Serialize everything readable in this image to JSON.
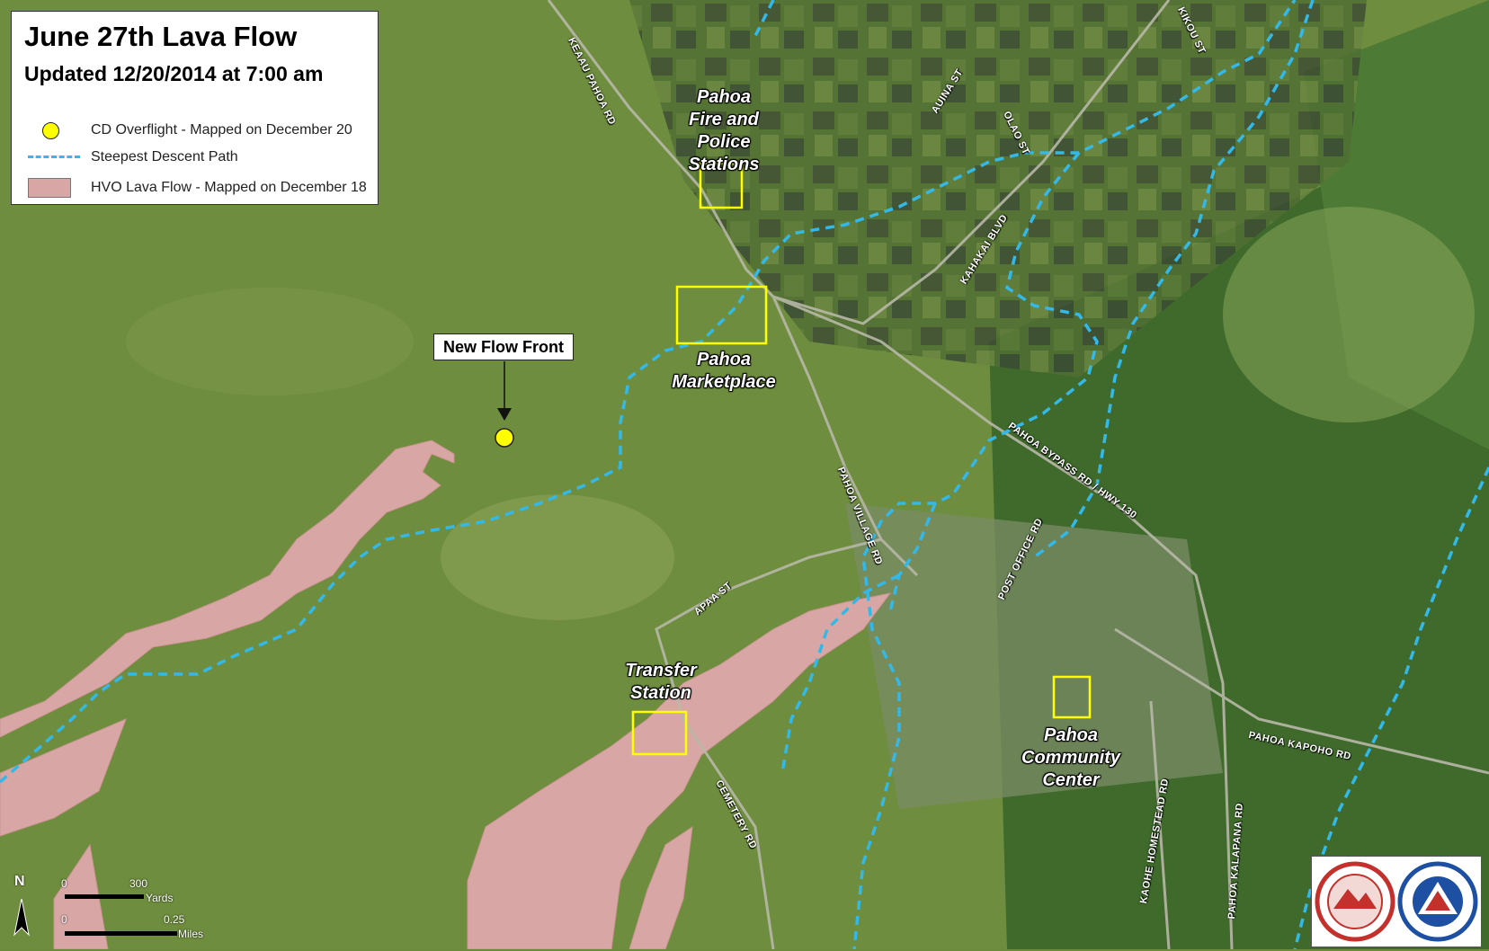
{
  "legend": {
    "title": "June 27th Lava Flow",
    "updated": "Updated 12/20/2014 at 7:00 am",
    "items": [
      {
        "label": "CD Overflight - Mapped on December 20",
        "icon": "yellow-dot-icon"
      },
      {
        "label": "Steepest Descent Path",
        "icon": "dashed-line-icon"
      },
      {
        "label": "HVO Lava Flow - Mapped on December 18",
        "icon": "pink-swatch-icon"
      }
    ]
  },
  "colors": {
    "lava": "#d8a7a5",
    "descent_path": "#33b8e8",
    "overflight": "#ffff00",
    "highlight_box": "#ffff00",
    "terrain": "#6b8a3c"
  },
  "callout": {
    "label": "New Flow Front"
  },
  "places": {
    "fire_police": "Pahoa\nFire and Police\nStations",
    "marketplace": "Pahoa\nMarketplace",
    "transfer": "Transfer\nStation",
    "community": "Pahoa\nCommunity\nCenter"
  },
  "roads": {
    "keaau": "KEAAU PAHOA RD",
    "kikou": "KIKOU ST",
    "auina": "AUINA ST",
    "olao": "OLAO ST",
    "kahakai": "KAHAKAI BLVD",
    "bypass": "PAHOA BYPASS RD / HWY 130",
    "village": "PAHOA VILLAGE RD",
    "postoffice": "POST OFFICE RD",
    "apaa": "APAA ST",
    "cemetery": "CEMETERY RD",
    "kaohe": "KAOHE HOMESTEAD RD",
    "kalapana": "PAHOA KALAPANA RD",
    "kapoho": "PAHOA KAPOHO RD"
  },
  "scale": {
    "north": "N",
    "yards_zero": "0",
    "yards_max": "300",
    "yards_unit": "Yards",
    "miles_zero": "0",
    "miles_max": "0.25",
    "miles_unit": "Miles"
  }
}
